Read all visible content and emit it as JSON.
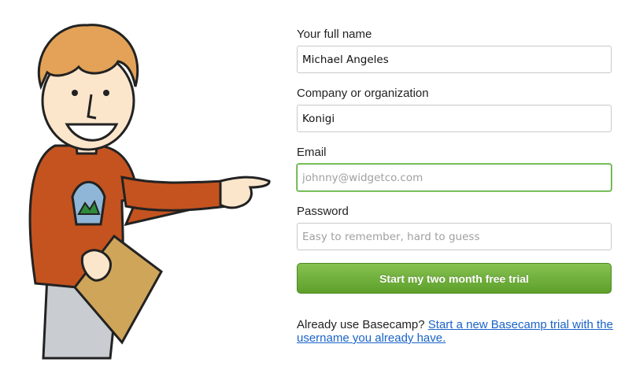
{
  "form": {
    "name_label": "Your full name",
    "name_value": "Michael Angeles",
    "company_label": "Company or organization",
    "company_value": "Konigi",
    "email_label": "Email",
    "email_placeholder": "johnny@widgetco.com",
    "password_label": "Password",
    "password_placeholder": "Easy to remember, hard to guess",
    "submit_label": "Start my two month free trial"
  },
  "footer": {
    "question": "Already use Basecamp?",
    "link_text": "Start a new Basecamp trial with the username you already have."
  },
  "colors": {
    "button_green": "#6aab37",
    "link_blue": "#1a63c9",
    "focus_green": "#5aa83c"
  }
}
